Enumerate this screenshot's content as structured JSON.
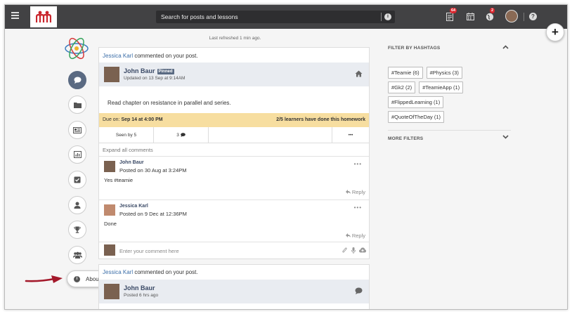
{
  "topbar": {
    "search_placeholder": "Search for posts and lessons",
    "notifications_count": "64",
    "activity_count": "2"
  },
  "feed": {
    "refreshed": "Last refreshed 1 min ago."
  },
  "post1": {
    "notif_who": "Jessica Karl",
    "notif_text": " commented on your post.",
    "author": "John Baur",
    "pinned_label": "Pinned",
    "updated": "Updated on 13 Sep at 9:14AM",
    "body": "Read chapter on resistance in parallel and series.",
    "due_prefix": "Due on: ",
    "due_date": "Sep 14 at 4:00 PM",
    "due_status": "2/5 learners have done this homework",
    "seen_by": "Seen by 5",
    "comment_count": "3",
    "more_dots": "•••",
    "expand_all": "Expand all comments",
    "comments": [
      {
        "name": "John Baur",
        "date": "Posted on 30 Aug at 3:24PM",
        "text": "Yes #teamie",
        "reply": "Reply"
      },
      {
        "name": "Jessica Karl",
        "date": "Posted on 9 Dec at 12:36PM",
        "text": "Done",
        "reply": "Reply"
      }
    ],
    "comment_placeholder": "Enter your comment here"
  },
  "post2": {
    "notif_who": "Jessica Karl",
    "notif_text": " commented on your post.",
    "author": "John Baur",
    "posted": "Posted 6 hrs ago"
  },
  "sidebar": {
    "about_label": "About"
  },
  "filters": {
    "hashtags_title": "FILTER BY HASHTAGS",
    "tags": [
      "#Teamie (6)",
      "#Physics (3)",
      "#Gk2 (2)",
      "#TeamieApp (1)",
      "#FlippedLearning (1)",
      "#QuoteOfTheDay (1)"
    ],
    "more_title": "MORE FILTERS"
  }
}
